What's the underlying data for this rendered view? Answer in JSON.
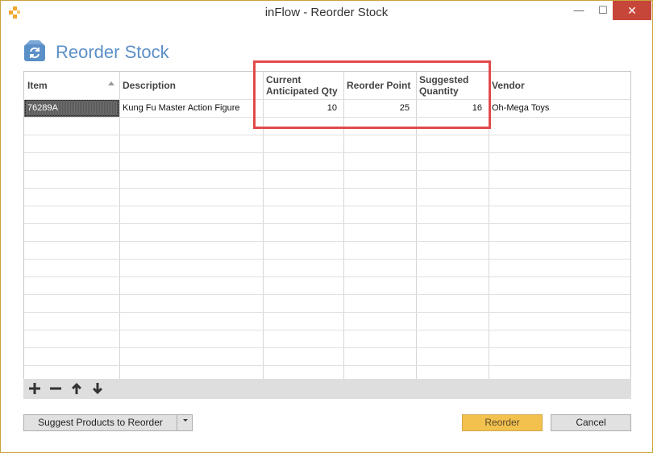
{
  "window": {
    "title": "inFlow - Reorder Stock",
    "minimize": "—",
    "maximize": "☐",
    "close": "✕"
  },
  "header": {
    "title": "Reorder Stock"
  },
  "grid": {
    "columns": [
      {
        "key": "item",
        "label": "Item"
      },
      {
        "key": "description",
        "label": "Description"
      },
      {
        "key": "current_qty",
        "label": "Current Anticipated Qty"
      },
      {
        "key": "reorder_point",
        "label": "Reorder Point"
      },
      {
        "key": "suggested_qty",
        "label": "Suggested Quantity"
      },
      {
        "key": "vendor",
        "label": "Vendor"
      }
    ],
    "rows": [
      {
        "item": "76289A",
        "description": "Kung Fu Master Action Figure",
        "current_qty": "10",
        "reorder_point": "25",
        "suggested_qty": "16",
        "vendor": "Oh-Mega Toys"
      }
    ]
  },
  "toolbar": {
    "add_icon": "plus-icon",
    "remove_icon": "minus-icon",
    "up_icon": "arrow-up-icon",
    "down_icon": "arrow-down-icon"
  },
  "buttons": {
    "suggest": "Suggest Products to Reorder",
    "reorder": "Reorder",
    "cancel": "Cancel"
  },
  "colors": {
    "accent_title": "#5b8fc7",
    "reorder_button": "#f2c14e",
    "highlight_box": "#e24a4a",
    "close_button": "#c7463a"
  }
}
